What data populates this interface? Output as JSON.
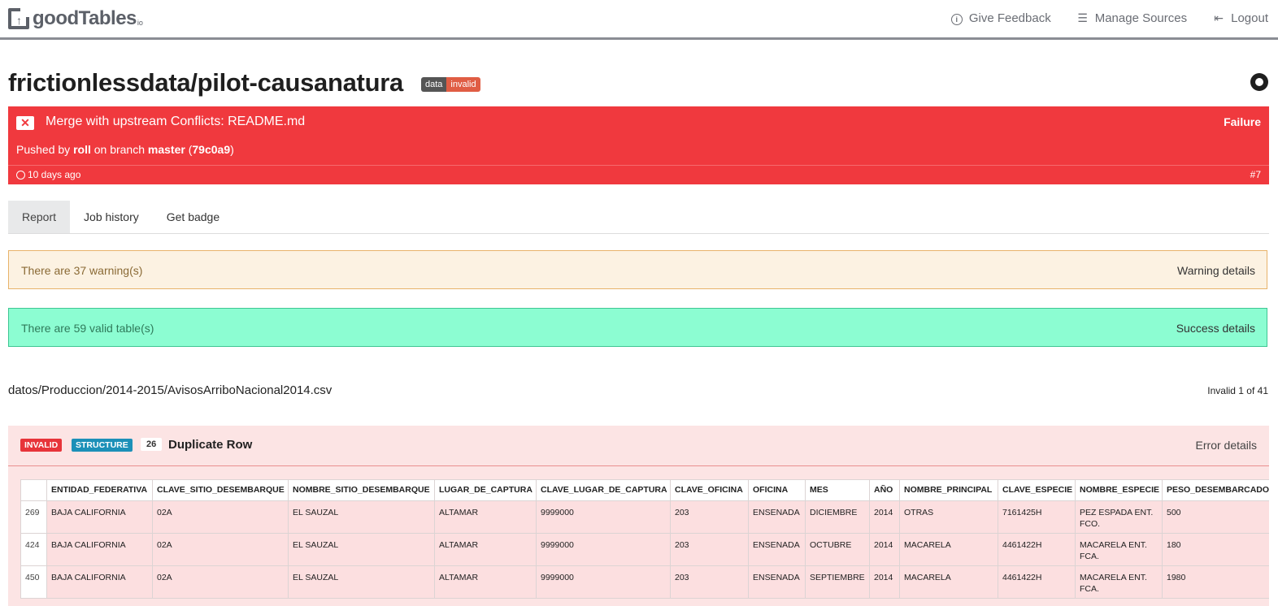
{
  "app": {
    "logo_text": "goodTables",
    "logo_suffix": "io"
  },
  "nav": {
    "items": [
      {
        "label": "Give Feedback",
        "icon": "info-icon"
      },
      {
        "label": "Manage Sources",
        "icon": "sliders-icon"
      },
      {
        "label": "Logout",
        "icon": "logout-icon"
      }
    ]
  },
  "repo": {
    "title": "frictionlessdata/pilot-causanatura",
    "badge_left": "data",
    "badge_right": "invalid"
  },
  "job": {
    "message": "Merge with upstream Conflicts: README.md",
    "status": "Failure",
    "pushed_prefix": "Pushed by",
    "user": "roll",
    "branch_prefix": "on branch",
    "branch": "master",
    "commit": "79c0a9",
    "time_ago": "10 days ago",
    "number": "#7",
    "colors": {
      "failure": "#f0393e"
    }
  },
  "tabs": [
    {
      "label": "Report",
      "active": true
    },
    {
      "label": "Job history",
      "active": false
    },
    {
      "label": "Get badge",
      "active": false
    }
  ],
  "alerts": {
    "warning_text": "There are 37 warning(s)",
    "warning_link": "Warning details",
    "success_text": "There are 59 valid table(s)",
    "success_link": "Success details"
  },
  "file": {
    "path": "datos/Produccion/2014-2015/AvisosArriboNacional2014.csv",
    "count": "Invalid 1 of 41"
  },
  "error": {
    "tag_invalid": "INVALID",
    "tag_structure": "STRUCTURE",
    "count": "26",
    "title": "Duplicate Row",
    "details_link": "Error details"
  },
  "table": {
    "headers": [
      "",
      "ENTIDAD_FEDERATIVA",
      "CLAVE_SITIO_DESEMBARQUE",
      "NOMBRE_SITIO_DESEMBARQUE",
      "LUGAR_DE_CAPTURA",
      "CLAVE_LUGAR_DE_CAPTURA",
      "CLAVE_OFICINA",
      "OFICINA",
      "MES",
      "AÑO",
      "NOMBRE_PRINCIPAL",
      "CLAVE_ESPECIE",
      "NOMBRE_ESPECIE",
      "PESO_DESEMBARCADO"
    ],
    "rows": [
      [
        "269",
        "BAJA CALIFORNIA",
        "02A",
        "EL SAUZAL",
        "ALTAMAR",
        "9999000",
        "203",
        "ENSENADA",
        "DICIEMBRE",
        "2014",
        "OTRAS",
        "7161425H",
        "PEZ ESPADA ENT. FCO.",
        "500"
      ],
      [
        "424",
        "BAJA CALIFORNIA",
        "02A",
        "EL SAUZAL",
        "ALTAMAR",
        "9999000",
        "203",
        "ENSENADA",
        "OCTUBRE",
        "2014",
        "MACARELA",
        "4461422H",
        "MACARELA ENT. FCA.",
        "180"
      ],
      [
        "450",
        "BAJA CALIFORNIA",
        "02A",
        "EL SAUZAL",
        "ALTAMAR",
        "9999000",
        "203",
        "ENSENADA",
        "SEPTIEMBRE",
        "2014",
        "MACARELA",
        "4461422H",
        "MACARELA ENT. FCA.",
        "1980"
      ]
    ]
  }
}
